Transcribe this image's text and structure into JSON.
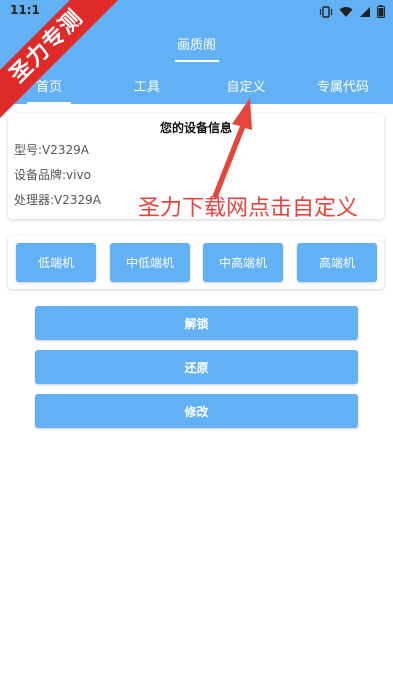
{
  "status_bar": {
    "time": "11:1",
    "icons": [
      "vibrate-icon",
      "wifi-icon",
      "signal-icon",
      "battery-icon"
    ]
  },
  "app": {
    "title": "画质阁"
  },
  "tabs": [
    {
      "label": "首页",
      "selected": true
    },
    {
      "label": "工具",
      "selected": false
    },
    {
      "label": "自定义",
      "selected": false
    },
    {
      "label": "专属代码",
      "selected": false
    }
  ],
  "device_info": {
    "heading": "您的设备信息",
    "model": "型号:V2329A",
    "brand": "设备品牌:vivo",
    "processor": "处理器:V2329A"
  },
  "tiers": [
    "低端机",
    "中低端机",
    "中高端机",
    "高端机"
  ],
  "actions": {
    "unlock": "解锁",
    "restore": "还原",
    "modify": "修改"
  },
  "watermark": {
    "ribbon_text": "圣力专测",
    "overlay_text": "圣力下载网点击自定义"
  },
  "colors": {
    "primary": "#63b1f5",
    "ribbon": "#e02a2a",
    "overlay_text": "#e6453c"
  }
}
